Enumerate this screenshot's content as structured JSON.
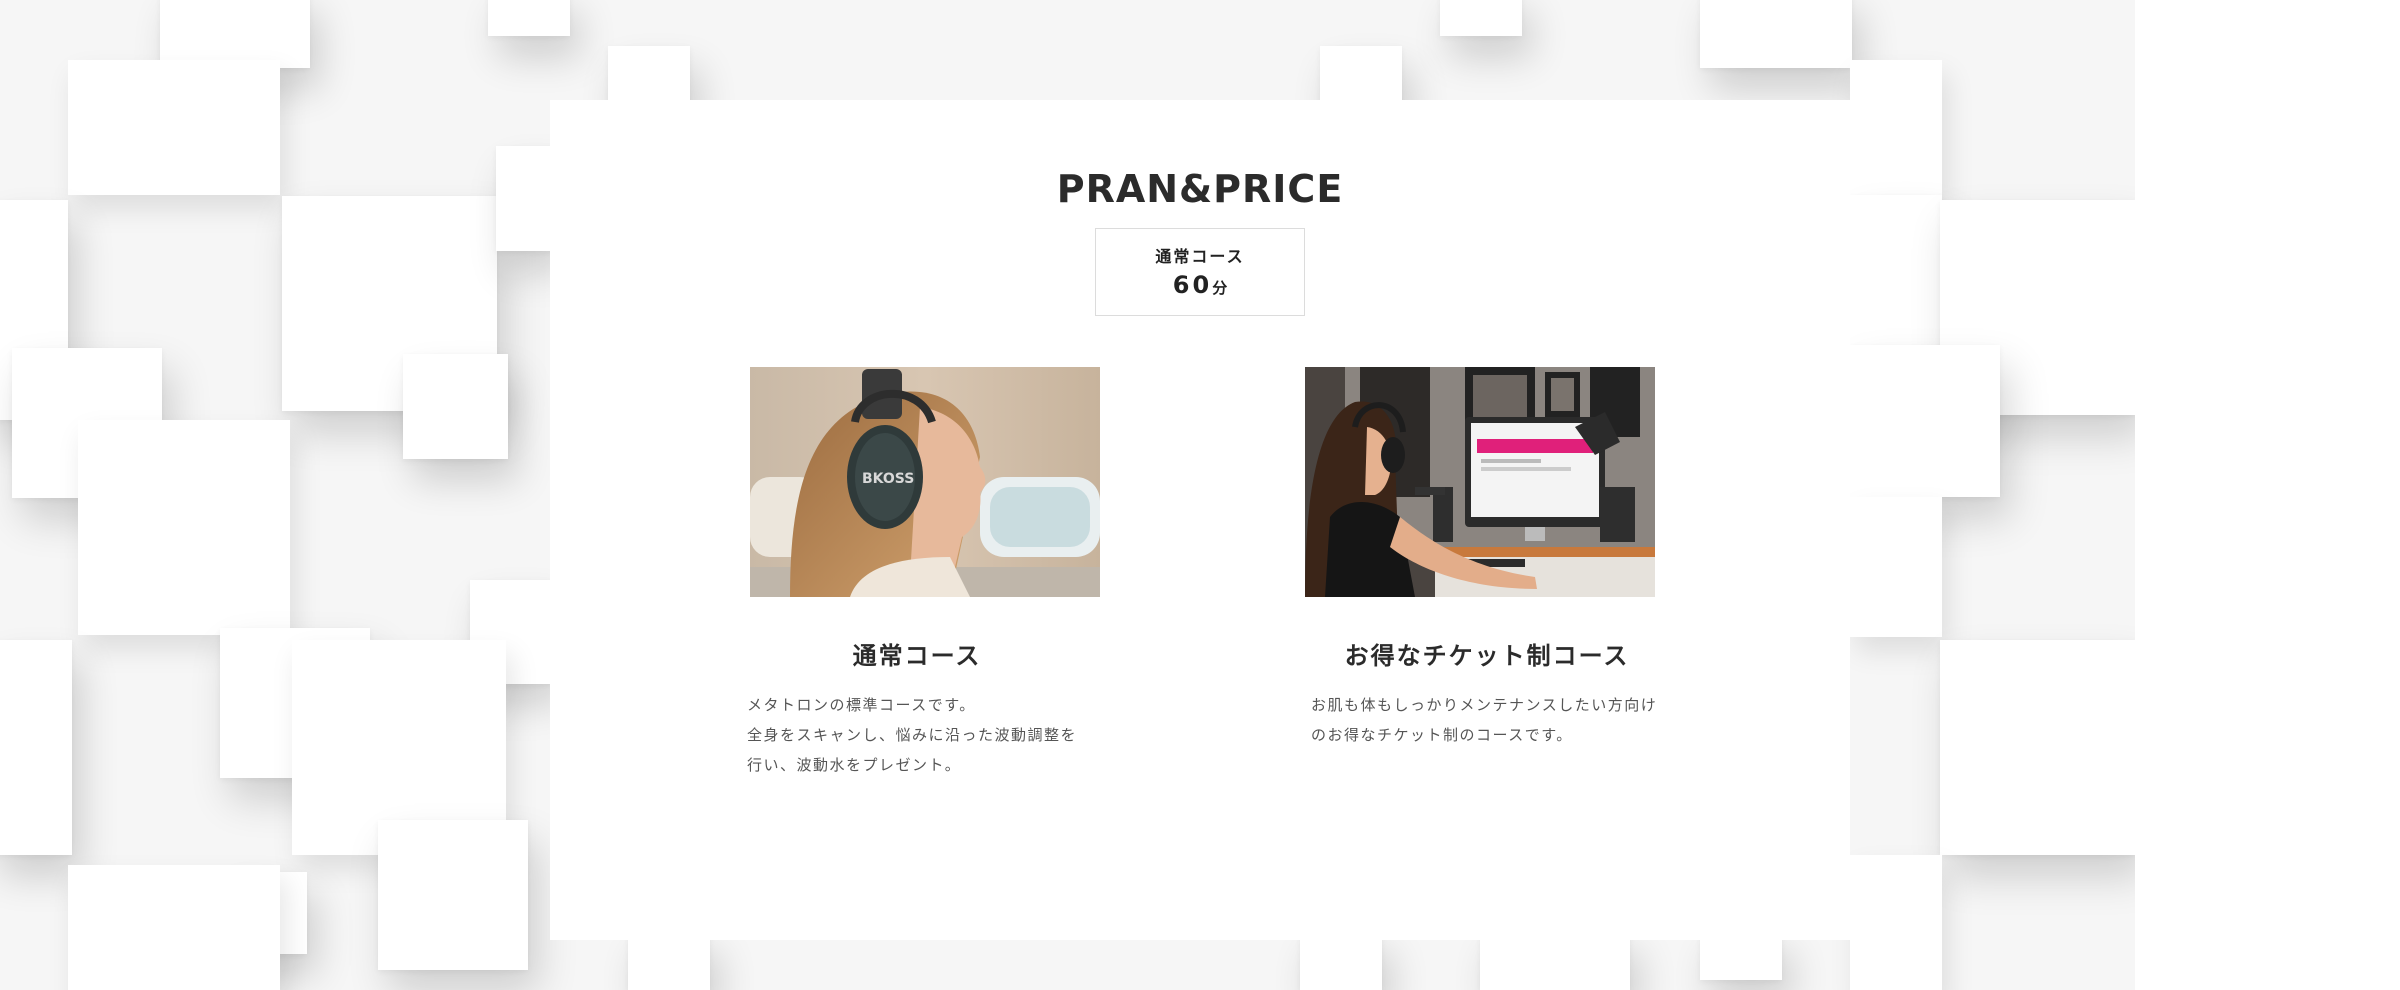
{
  "section": {
    "title": "PRAN&PRICE"
  },
  "price_box": {
    "label": "通常コース",
    "value": "60",
    "unit": "分"
  },
  "courses": [
    {
      "title": "通常コース",
      "image_icon": "woman-headphones-photo",
      "description": [
        "メタトロンの標準コースです。",
        "全身をスキャンし、悩みに沿った波動調整を",
        "行い、波動水をプレゼント。"
      ]
    },
    {
      "title": "お得なチケット制コース",
      "image_icon": "woman-computer-photo",
      "description": [
        "お肌も体もしっかりメンテナンスしたい方向け",
        "のお得なチケット制のコースです。"
      ]
    }
  ],
  "colors": {
    "background": "#f6f6f6",
    "card": "#ffffff",
    "title": "#2b2b2b",
    "text": "#555555",
    "accent_screen": "#e0207a"
  }
}
